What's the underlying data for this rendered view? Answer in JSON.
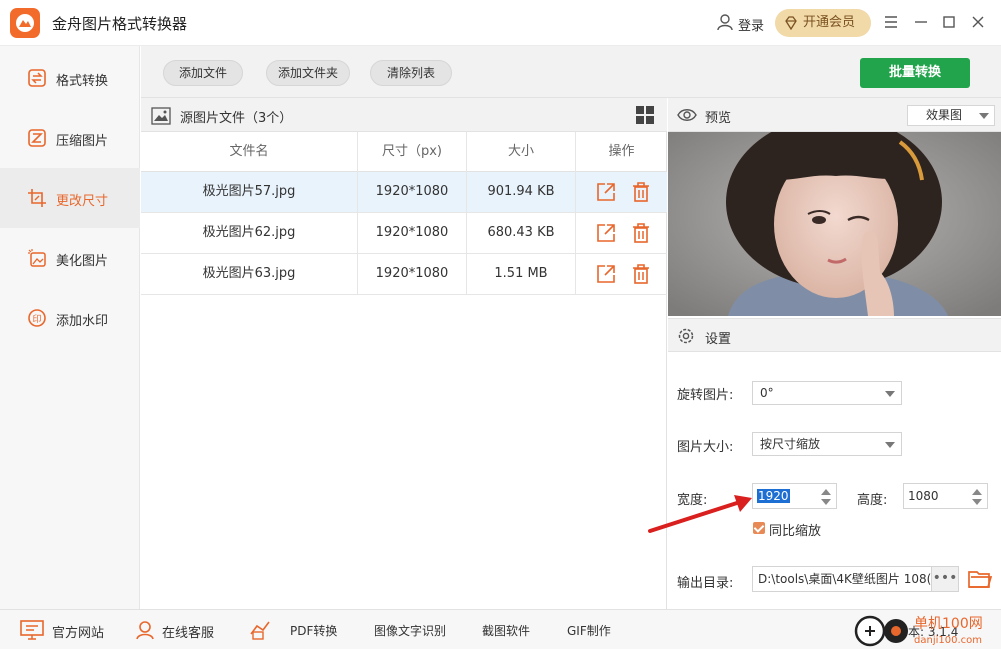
{
  "app": {
    "title": "金舟图片格式转换器"
  },
  "header": {
    "login": "登录",
    "vip": "开通会员"
  },
  "sidebar": {
    "items": [
      {
        "label": "格式转换",
        "icon": "format-convert-icon"
      },
      {
        "label": "压缩图片",
        "icon": "compress-icon"
      },
      {
        "label": "更改尺寸",
        "icon": "resize-icon",
        "active": true
      },
      {
        "label": "美化图片",
        "icon": "beautify-icon"
      },
      {
        "label": "添加水印",
        "icon": "watermark-icon"
      }
    ]
  },
  "toolbar": {
    "add_file": "添加文件",
    "add_folder": "添加文件夹",
    "clear_list": "清除列表",
    "batch_convert": "批量转换"
  },
  "file_panel": {
    "title": "源图片文件（3个）",
    "columns": [
      "文件名",
      "尺寸（px)",
      "大小",
      "操作"
    ],
    "rows": [
      {
        "name": "极光图片57.jpg",
        "size_px": "1920*1080",
        "size": "901.94 KB"
      },
      {
        "name": "极光图片62.jpg",
        "size_px": "1920*1080",
        "size": "680.43 KB"
      },
      {
        "name": "极光图片63.jpg",
        "size_px": "1920*1080",
        "size": "1.51 MB"
      }
    ]
  },
  "preview": {
    "title": "预览",
    "mode": "效果图"
  },
  "settings": {
    "title": "设置",
    "rotate_label": "旋转图片:",
    "rotate_value": "0°",
    "size_label": "图片大小:",
    "size_value": "按尺寸缩放",
    "width_label": "宽度:",
    "width_value": "1920",
    "height_label": "高度:",
    "height_value": "1080",
    "keep_ratio": "同比缩放",
    "output_label": "输出目录:",
    "output_value": "D:\\tools\\桌面\\4K壁纸图片 108("
  },
  "footer": {
    "website": "官方网站",
    "support": "在线客服",
    "pdf": "PDF转换",
    "ocr": "图像文字识别",
    "screenshot": "截图软件",
    "gif": "GIF制作",
    "version": "本: 3.1.4"
  },
  "watermark_text": "单机100网 danji100.com",
  "colors": {
    "accent": "#e8672c",
    "primary": "#22a44c",
    "vip": "#f1d9a8",
    "arrow": "#d9201e"
  }
}
